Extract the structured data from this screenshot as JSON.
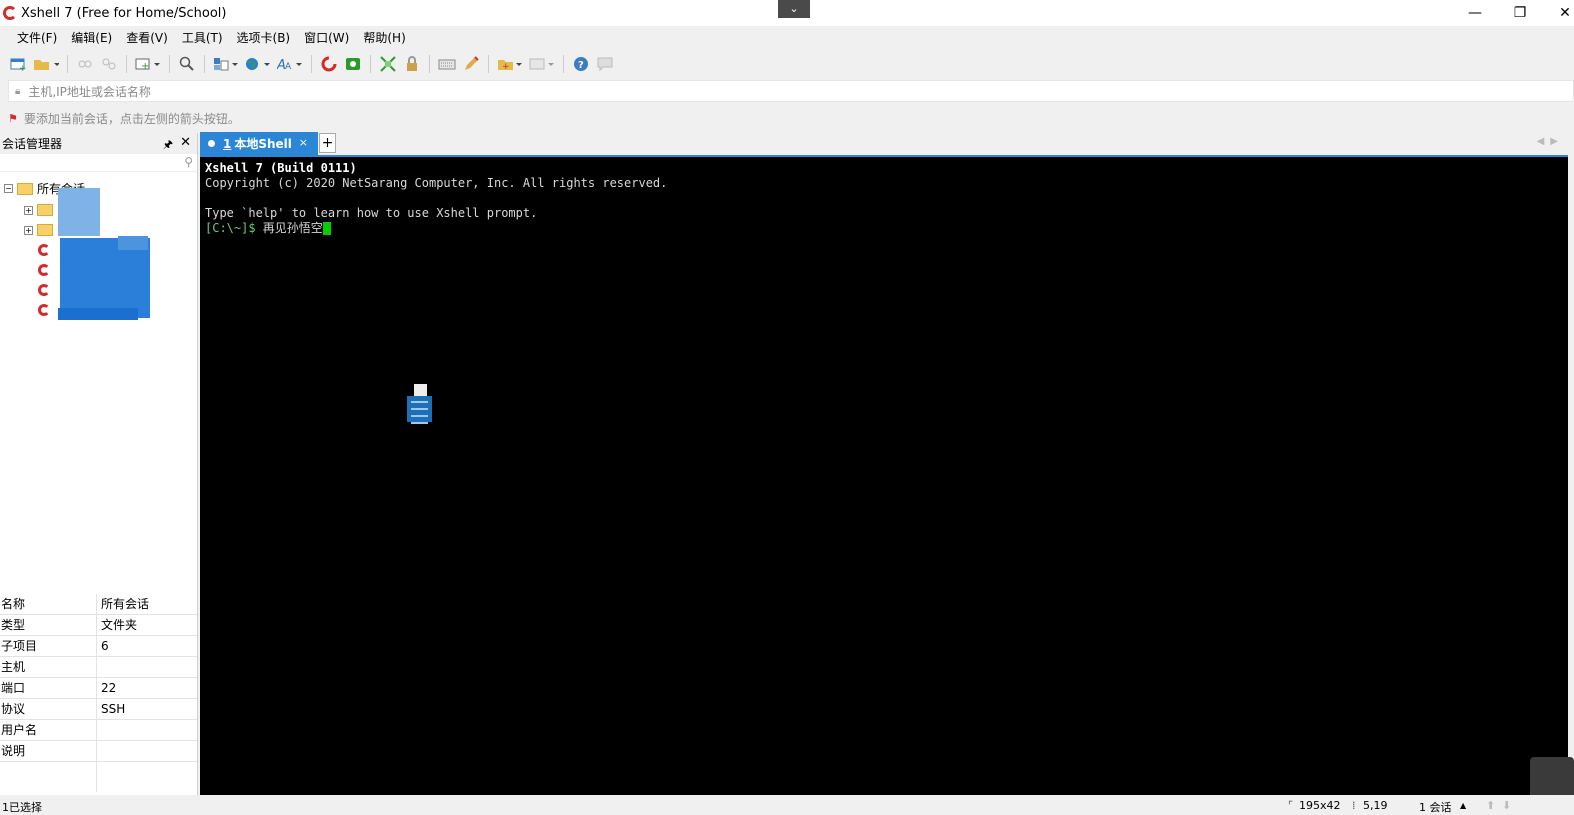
{
  "window": {
    "title": "Xshell 7 (Free for Home/School)",
    "dropdown_glyph": "⌄",
    "minimize": "—",
    "restore": "❐",
    "close": "✕"
  },
  "menu": [
    "文件(F)",
    "编辑(E)",
    "查看(V)",
    "工具(T)",
    "选项卡(B)",
    "窗口(W)",
    "帮助(H)"
  ],
  "address": {
    "placeholder": "主机,IP地址或会话名称"
  },
  "hint": "要添加当前会话，点击左侧的箭头按钮。",
  "session_manager": {
    "title": "会话管理器",
    "pin": "🖈",
    "close": "✕",
    "root_label": "所有会话"
  },
  "properties": [
    {
      "key": "名称",
      "value": "所有会话"
    },
    {
      "key": "类型",
      "value": "文件夹"
    },
    {
      "key": "子项目",
      "value": "6"
    },
    {
      "key": "主机",
      "value": ""
    },
    {
      "key": "端口",
      "value": "22"
    },
    {
      "key": "协议",
      "value": "SSH"
    },
    {
      "key": "用户名",
      "value": ""
    },
    {
      "key": "说明",
      "value": ""
    }
  ],
  "tab": {
    "number": "1",
    "label": "本地Shell",
    "close": "×",
    "add": "+"
  },
  "terminal": {
    "line1": "Xshell 7 (Build 0111)",
    "line2": "Copyright (c) 2020 NetSarang Computer, Inc. All rights reserved.",
    "line3": "",
    "line4": "Type `help' to learn how to use Xshell prompt.",
    "prompt": "[C:\\~]$",
    "input": " 再见孙悟空"
  },
  "status": {
    "selection": "1已选择",
    "size": "195x42",
    "cursor_pos": "5,19",
    "sessions": "1 会话"
  },
  "colors": {
    "tab_blue": "#2b87d6",
    "prompt_green": "#6ad06a",
    "cursor_green": "#00d000"
  }
}
